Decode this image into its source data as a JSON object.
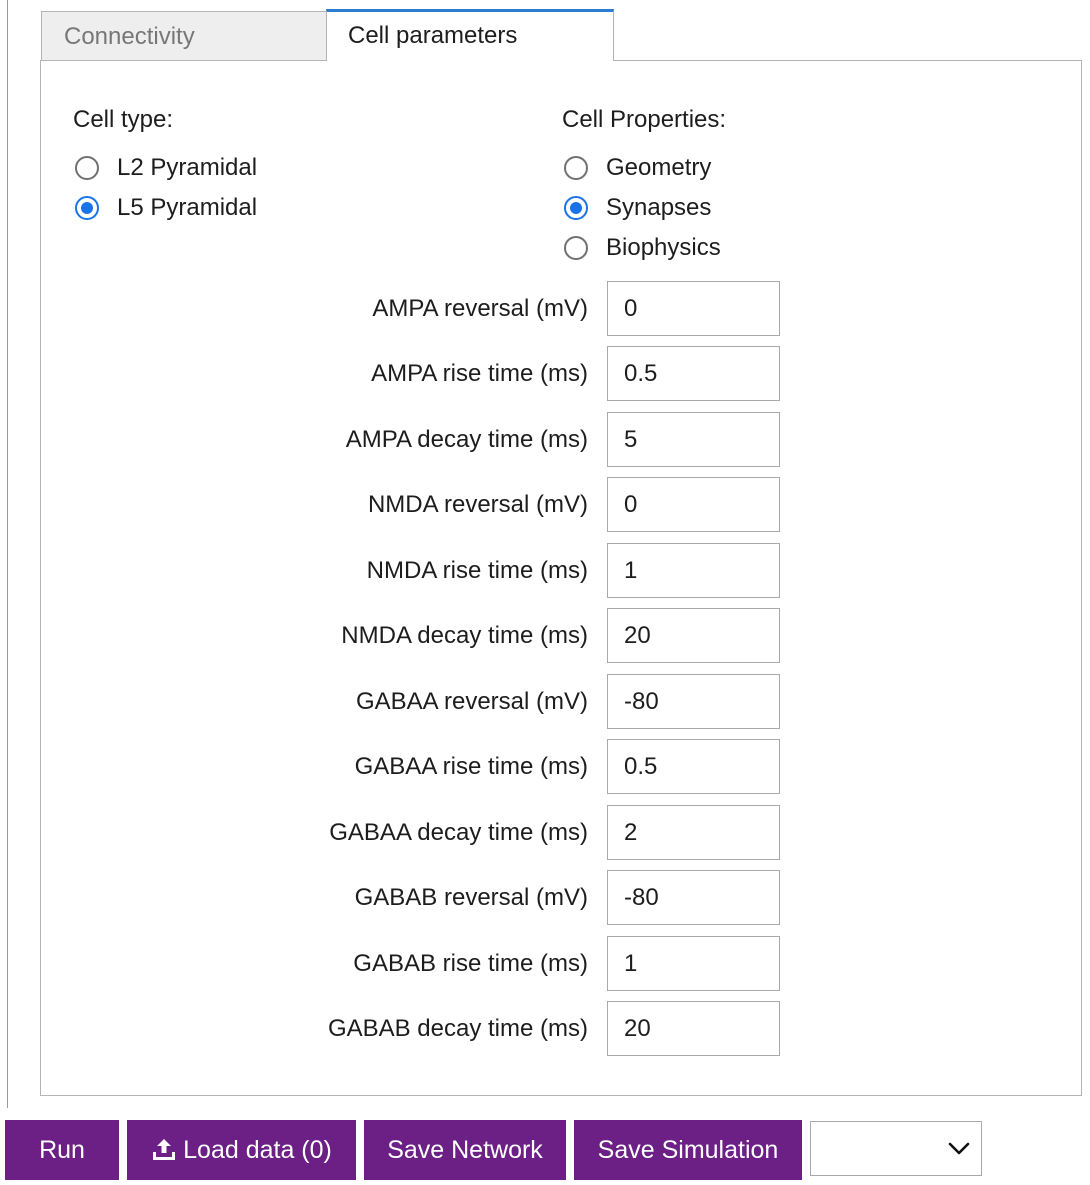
{
  "tabs": [
    {
      "label": "Connectivity",
      "active": false
    },
    {
      "label": "Cell parameters",
      "active": true
    }
  ],
  "cell_type": {
    "title": "Cell type:",
    "options": [
      {
        "label": "L2 Pyramidal",
        "checked": false
      },
      {
        "label": "L5 Pyramidal",
        "checked": true
      }
    ]
  },
  "cell_properties": {
    "title": "Cell Properties:",
    "options": [
      {
        "label": "Geometry",
        "checked": false
      },
      {
        "label": "Synapses",
        "checked": true
      },
      {
        "label": "Biophysics",
        "checked": false
      }
    ]
  },
  "params": [
    {
      "label": "AMPA reversal (mV)",
      "value": "0"
    },
    {
      "label": "AMPA rise time (ms)",
      "value": "0.5"
    },
    {
      "label": "AMPA decay time (ms)",
      "value": "5"
    },
    {
      "label": "NMDA reversal (mV)",
      "value": "0"
    },
    {
      "label": "NMDA rise time (ms)",
      "value": "1"
    },
    {
      "label": "NMDA decay time (ms)",
      "value": "20"
    },
    {
      "label": "GABAA reversal (mV)",
      "value": "-80"
    },
    {
      "label": "GABAA rise time (ms)",
      "value": "0.5"
    },
    {
      "label": "GABAA decay time (ms)",
      "value": "2"
    },
    {
      "label": "GABAB reversal (mV)",
      "value": "-80"
    },
    {
      "label": "GABAB rise time (ms)",
      "value": "1"
    },
    {
      "label": "GABAB decay time (ms)",
      "value": "20"
    }
  ],
  "buttons": {
    "run": "Run",
    "load_data": "Load data (0)",
    "save_network": "Save Network",
    "save_simulation": "Save Simulation"
  },
  "dropdown": {
    "selected": ""
  },
  "colors": {
    "button_bg": "#6c1f85",
    "radio_accent": "#1a73e8",
    "tab_accent": "#2b7bd1"
  },
  "icons": {
    "load_data": "upload-icon",
    "dropdown": "chevron-down-icon"
  }
}
